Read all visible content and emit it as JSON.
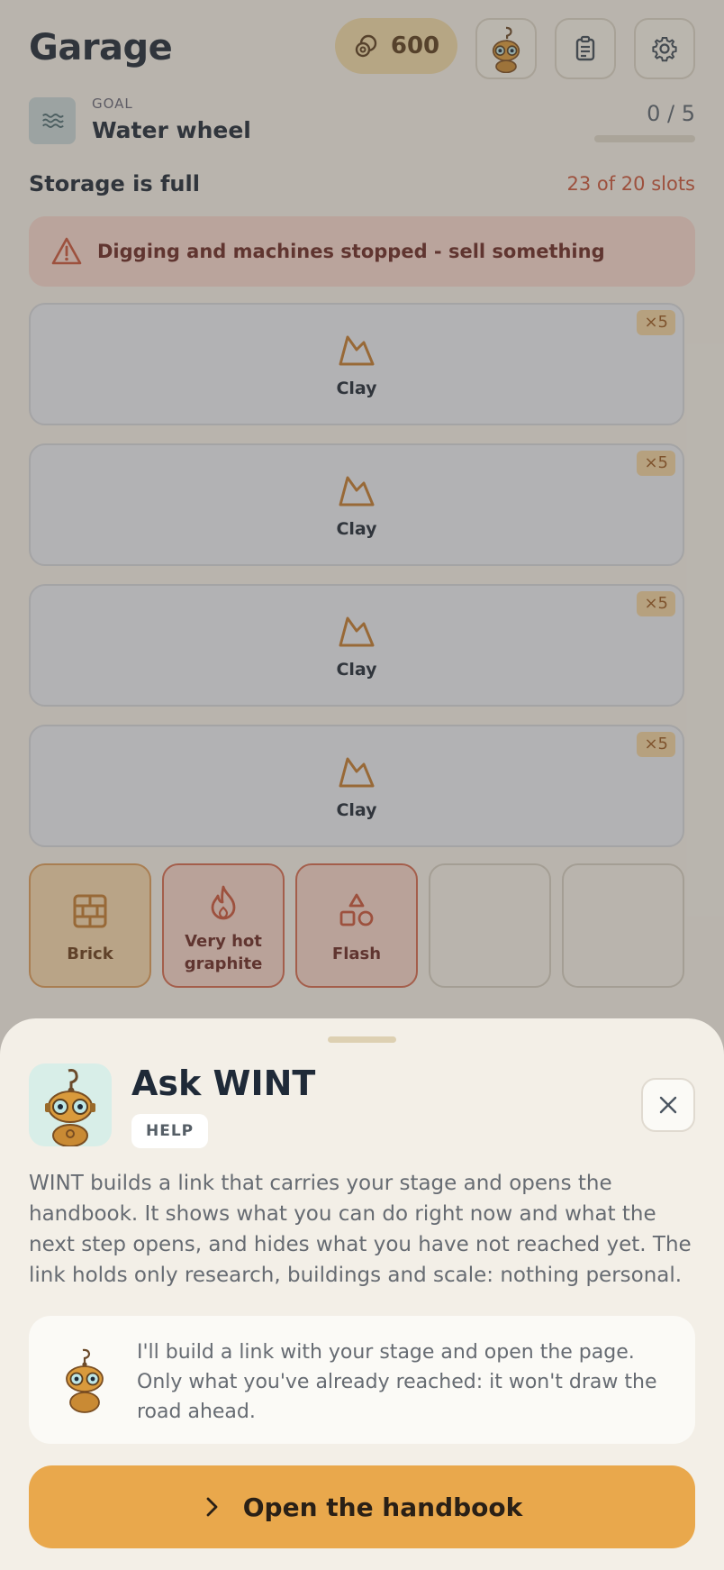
{
  "header": {
    "title": "Garage",
    "coins": "600",
    "icons": [
      "coins-icon",
      "robot-avatar",
      "clipboard-icon",
      "gear-icon"
    ]
  },
  "goal": {
    "tag": "GOAL",
    "name": "Water wheel",
    "progress": "0 / 5",
    "progress_fraction": 0
  },
  "storage": {
    "title": "Storage is full",
    "slots": "23 of 20 slots",
    "alert": "Digging and machines stopped - sell something"
  },
  "items": [
    {
      "label": "Clay",
      "qty": "×5"
    },
    {
      "label": "Clay",
      "qty": "×5"
    },
    {
      "label": "Clay",
      "qty": "×5"
    },
    {
      "label": "Clay",
      "qty": "×5"
    }
  ],
  "tiles": [
    {
      "label": "Brick"
    },
    {
      "label": "Very hot graphite"
    },
    {
      "label": "Flash"
    }
  ],
  "sheet": {
    "title": "Ask WINT",
    "badge": "HELP",
    "body": "WINT builds a link that carries your stage and opens the handbook. It shows what you can do right now and what the next step opens, and hides what you have not reached yet. The link holds only research, buildings and scale: nothing personal.",
    "bubble": "I'll build a link with your stage and open the page. Only what you've already reached: it won't draw the road ahead.",
    "cta": "Open the handbook"
  },
  "colors": {
    "accent": "#e9a84c",
    "danger": "#c8553a",
    "background": "#f4f0e8"
  }
}
